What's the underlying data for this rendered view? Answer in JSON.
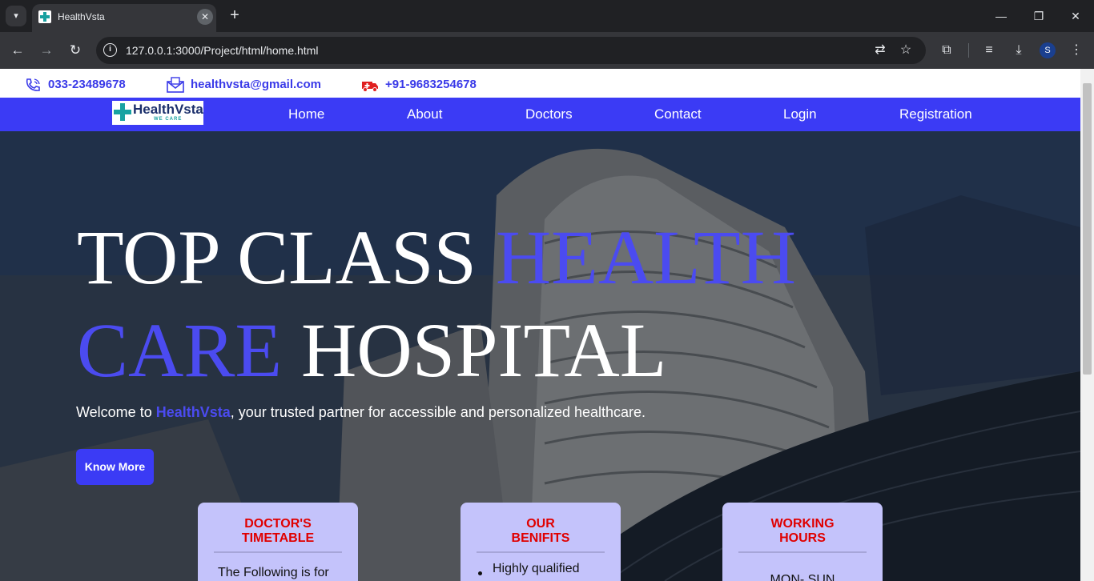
{
  "browser": {
    "tab_title": "HealthVsta",
    "url": "127.0.0.1:3000/Project/html/home.html",
    "icons": [
      "tab-search-icon",
      "favicon-icon",
      "close-icon",
      "plus-icon",
      "minimize-icon",
      "restore-icon",
      "close-window-icon",
      "back-icon",
      "forward-icon",
      "reload-icon",
      "info-icon",
      "translate-icon",
      "star-icon",
      "extensions-icon",
      "media-icon",
      "download-icon",
      "menu-icon"
    ],
    "profile_initial": "S"
  },
  "contact": {
    "phone": "033-23489678",
    "email": "healthvsta@gmail.com",
    "emergency": "+91-9683254678",
    "accent_color": "#3a3ae8"
  },
  "navbar": {
    "logo_name": "HealthVsta",
    "logo_tagline": "WE CARE",
    "links": [
      "Home",
      "About",
      "Doctors",
      "Contact",
      "Login",
      "Registration"
    ],
    "background_color": "#3b3bf5"
  },
  "hero": {
    "headline_line1_white": "TOP CLASS ",
    "headline_line1_accent": "HEALTH",
    "headline_line2_accent": "CARE",
    "headline_line2_white": " HOSPITAL",
    "welcome_prefix": "Welcome to ",
    "welcome_brand": "HealthVsta",
    "welcome_suffix": ", your trusted partner for accessible and personalized healthcare.",
    "button_label": "Know More",
    "accent_color": "#4b4bf0"
  },
  "cards": [
    {
      "title_line1": "DOCTOR'S",
      "title_line2": "TIMETABLE",
      "body": "The Following is for"
    },
    {
      "title_line1": "OUR",
      "title_line2": "BENIFITS",
      "body": "Highly qualified"
    },
    {
      "title_line1": "WORKING",
      "title_line2": "HOURS",
      "body": "MON- SUN"
    }
  ]
}
